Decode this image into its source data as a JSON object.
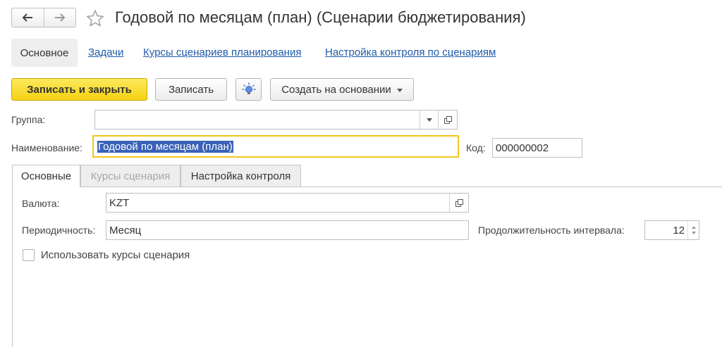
{
  "window": {
    "title": "Годовой по месяцам (план) (Сценарии бюджетирования)"
  },
  "nav": {
    "back_icon": "arrow-left-icon",
    "forward_icon": "arrow-right-icon",
    "favorite_icon": "star-icon"
  },
  "sections": [
    {
      "label": "Основное",
      "active": true
    },
    {
      "label": "Задачи"
    },
    {
      "label": "Курсы сценариев планирования"
    },
    {
      "label": "Настройка контроля по сценариям"
    }
  ],
  "toolbar": {
    "save_close_label": "Записать и закрыть",
    "save_label": "Записать",
    "idea_icon": "lightbulb-icon",
    "create_based_label": "Создать на основании"
  },
  "form": {
    "group_label": "Группа:",
    "group_value": "",
    "name_label": "Наименование:",
    "name_value": "Годовой по месяцам (план)",
    "code_label": "Код:",
    "code_value": "000000002"
  },
  "tabs": [
    {
      "label": "Основные",
      "active": true
    },
    {
      "label": "Курсы сценария",
      "disabled": true
    },
    {
      "label": "Настройка контроля"
    }
  ],
  "main_tab": {
    "currency_label": "Валюта:",
    "currency_value": "KZT",
    "periodicity_label": "Периодичность:",
    "periodicity_value": "Месяц",
    "interval_label": "Продолжительность интервала:",
    "interval_value": "12",
    "use_rates_label": "Использовать курсы сценария",
    "use_rates_checked": false
  },
  "colors": {
    "primary_button": "#f5d214",
    "link": "#1f5ba8",
    "focus_border": "#f2c71c",
    "selection": "#3a62b8"
  }
}
